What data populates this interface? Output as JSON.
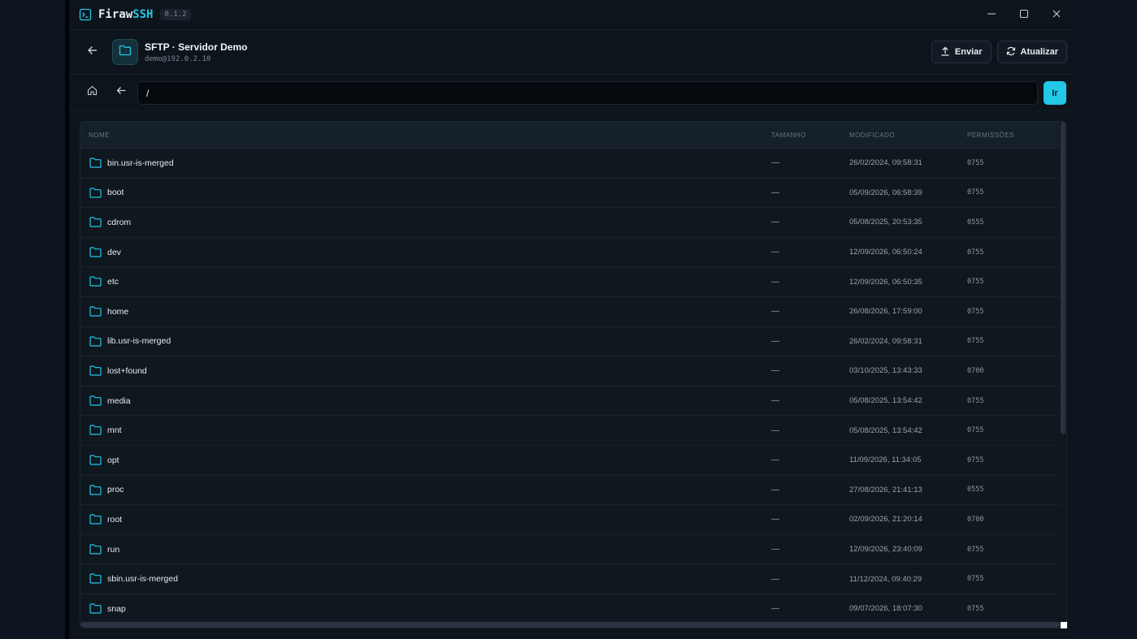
{
  "app": {
    "name_primary": "Firaw",
    "name_accent": "SSH",
    "version": "0.1.2"
  },
  "header": {
    "title": "SFTP · Servidor Demo",
    "subtitle": "demo@192.0.2.10",
    "upload_label": "Enviar",
    "refresh_label": "Atualizar"
  },
  "pathbar": {
    "path_value": "/",
    "go_label": "Ir"
  },
  "table": {
    "columns": {
      "name": "NOME",
      "size": "TAMANHO",
      "modified": "MODIFICADO",
      "permissions": "PERMISSÕES"
    },
    "rows": [
      {
        "name": "bin.usr-is-merged",
        "size": "—",
        "modified": "26/02/2024, 09:58:31",
        "perm": "0755"
      },
      {
        "name": "boot",
        "size": "—",
        "modified": "05/09/2026, 06:58:39",
        "perm": "0755"
      },
      {
        "name": "cdrom",
        "size": "—",
        "modified": "05/08/2025, 20:53:35",
        "perm": "0555"
      },
      {
        "name": "dev",
        "size": "—",
        "modified": "12/09/2026, 06:50:24",
        "perm": "0755"
      },
      {
        "name": "etc",
        "size": "—",
        "modified": "12/09/2026, 06:50:35",
        "perm": "0755"
      },
      {
        "name": "home",
        "size": "—",
        "modified": "26/08/2026, 17:59:00",
        "perm": "0755"
      },
      {
        "name": "lib.usr-is-merged",
        "size": "—",
        "modified": "26/02/2024, 09:58:31",
        "perm": "0755"
      },
      {
        "name": "lost+found",
        "size": "—",
        "modified": "03/10/2025, 13:43:33",
        "perm": "0700"
      },
      {
        "name": "media",
        "size": "—",
        "modified": "05/08/2025, 13:54:42",
        "perm": "0755"
      },
      {
        "name": "mnt",
        "size": "—",
        "modified": "05/08/2025, 13:54:42",
        "perm": "0755"
      },
      {
        "name": "opt",
        "size": "—",
        "modified": "11/09/2026, 11:34:05",
        "perm": "0755"
      },
      {
        "name": "proc",
        "size": "—",
        "modified": "27/08/2026, 21:41:13",
        "perm": "0555"
      },
      {
        "name": "root",
        "size": "—",
        "modified": "02/09/2026, 21:20:14",
        "perm": "0700"
      },
      {
        "name": "run",
        "size": "—",
        "modified": "12/09/2026, 23:40:09",
        "perm": "0755"
      },
      {
        "name": "sbin.usr-is-merged",
        "size": "—",
        "modified": "11/12/2024, 09:40:29",
        "perm": "0755"
      },
      {
        "name": "snap",
        "size": "—",
        "modified": "09/07/2026, 18:07:30",
        "perm": "0755"
      }
    ]
  },
  "icons": {
    "logo": "terminal-icon",
    "minimize": "minimize-icon",
    "maximize": "maximize-icon",
    "close": "close-icon",
    "back": "arrow-left-icon",
    "folder": "folder-icon",
    "upload": "upload-icon",
    "refresh": "refresh-icon",
    "home": "home-icon"
  },
  "colors": {
    "accent": "#22c8e6",
    "background": "#0d141c"
  }
}
